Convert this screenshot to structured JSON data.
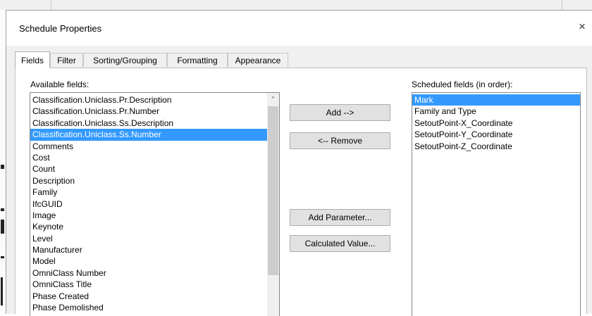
{
  "dialog": {
    "title": "Schedule Properties",
    "close_glyph": "×"
  },
  "tabs": [
    {
      "label": "Fields",
      "active": true
    },
    {
      "label": "Filter",
      "active": false
    },
    {
      "label": "Sorting/Grouping",
      "active": false
    },
    {
      "label": "Formatting",
      "active": false
    },
    {
      "label": "Appearance",
      "active": false
    }
  ],
  "available": {
    "label": "Available fields:",
    "items": [
      "Classification.Uniclass.Pr.Description",
      "Classification.Uniclass.Pr.Number",
      "Classification.Uniclass.Ss.Description",
      "Classification.Uniclass.Ss.Number",
      "Comments",
      "Cost",
      "Count",
      "Description",
      "Family",
      "IfcGUID",
      "Image",
      "Keynote",
      "Level",
      "Manufacturer",
      "Model",
      "OmniClass Number",
      "OmniClass Title",
      "Phase Created",
      "Phase Demolished"
    ],
    "selected": "Classification.Uniclass.Ss.Number",
    "scroll_up_glyph": "^"
  },
  "buttons": {
    "add": "Add -->",
    "remove": "<-- Remove",
    "add_parameter": "Add Parameter...",
    "calculated_value": "Calculated Value..."
  },
  "scheduled": {
    "label": "Scheduled fields (in order):",
    "items": [
      "Mark",
      "Family and Type",
      "SetoutPoint-X_Coordinate",
      "SetoutPoint-Y_Coordinate",
      "SetoutPoint-Z_Coordinate"
    ],
    "selected": "Mark"
  },
  "colors": {
    "selection": "#3399ff",
    "dialog_bg": "#f0f0f0",
    "button_bg": "#e1e1e1"
  }
}
